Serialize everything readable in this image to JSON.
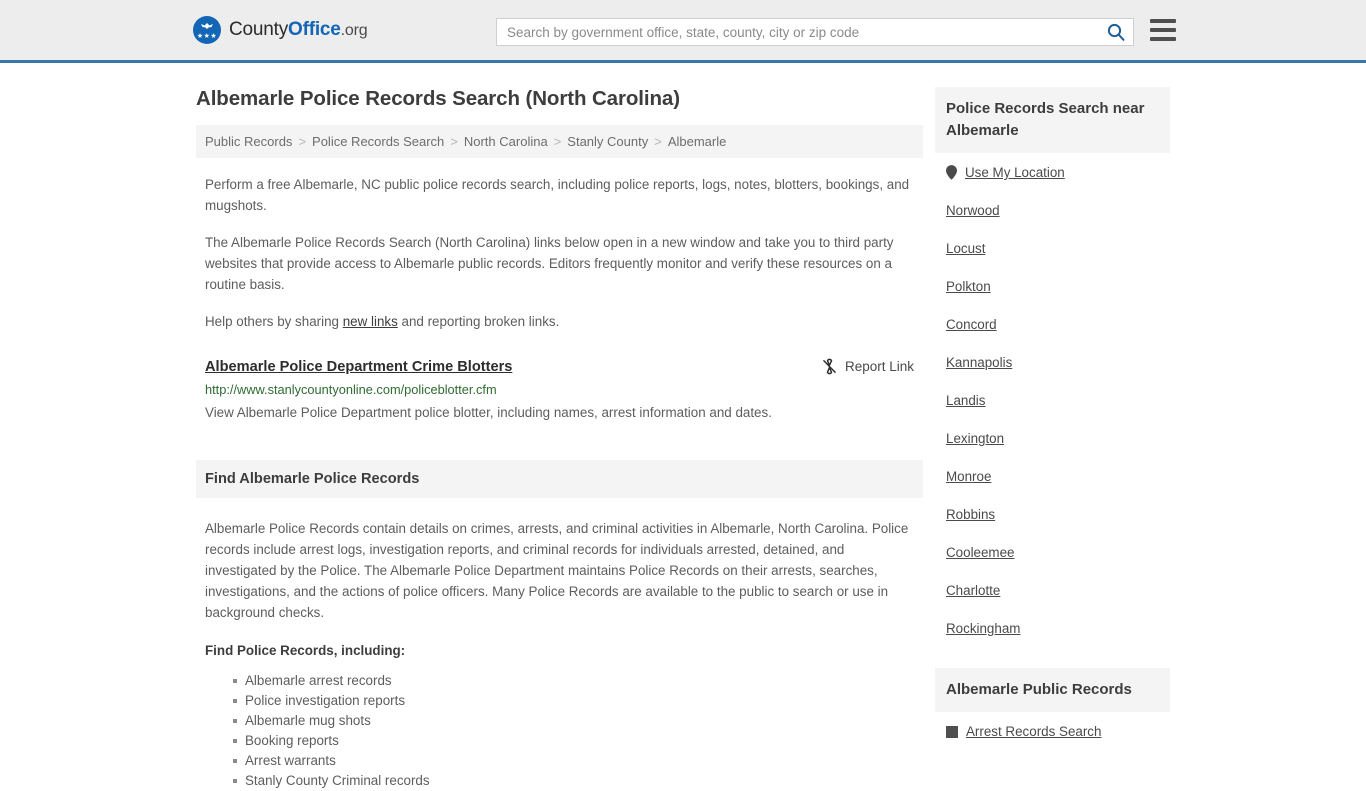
{
  "header": {
    "brand": {
      "part1": "County",
      "part2": "Office",
      "part3": ".org",
      "logo_icon": "eagle-seal-icon",
      "stars": "★★★"
    },
    "search": {
      "placeholder": "Search by government office, state, county, city or zip code",
      "value": "",
      "icon": "search-icon"
    },
    "menu_icon": "hamburger-menu-icon",
    "accent_color": "#3a76a8",
    "background_color": "#ededed"
  },
  "page": {
    "title": "Albemarle Police Records Search (North Carolina)"
  },
  "breadcrumb": {
    "separator": ">",
    "items": [
      "Public Records",
      "Police Records Search",
      "North Carolina",
      "Stanly County",
      "Albemarle"
    ]
  },
  "intro": {
    "p1": "Perform a free Albemarle, NC public police records search, including police reports, logs, notes, blotters, bookings, and mugshots.",
    "p2": "The Albemarle Police Records Search (North Carolina) links below open in a new window and take you to third party websites that provide access to Albemarle public records. Editors frequently monitor and verify these resources on a routine basis.",
    "p3_before": "Help others by sharing ",
    "p3_link": "new links",
    "p3_after": " and reporting broken links."
  },
  "result": {
    "title": "Albemarle Police Department Crime Blotters",
    "url": "http://www.stanlycountyonline.com/policeblotter.cfm",
    "url_color": "#2f6b32",
    "description": "View Albemarle Police Department police blotter, including names, arrest information and dates.",
    "report_label": "Report Link",
    "report_icon": "broken-link-icon"
  },
  "section": {
    "heading": "Find Albemarle Police Records",
    "body": "Albemarle Police Records contain details on crimes, arrests, and criminal activities in Albemarle, North Carolina. Police records include arrest logs, investigation reports, and criminal records for individuals arrested, detained, and investigated by the Police. The Albemarle Police Department maintains Police Records on their arrests, searches, investigations, and the actions of police officers. Many Police Records are available to the public to search or use in background checks.",
    "list_heading": "Find Police Records, including:",
    "bullets": [
      "Albemarle arrest records",
      "Police investigation reports",
      "Albemarle mug shots",
      "Booking reports",
      "Arrest warrants",
      "Stanly County Criminal records"
    ]
  },
  "sidebar": {
    "nearby": {
      "heading": "Police Records Search near Albemarle",
      "use_my_location": "Use My Location",
      "location_icon": "map-pin-icon",
      "cities": [
        "Norwood",
        "Locust",
        "Polkton",
        "Concord",
        "Kannapolis",
        "Landis",
        "Lexington",
        "Monroe",
        "Robbins",
        "Cooleemee",
        "Charlotte",
        "Rockingham"
      ]
    },
    "public_records": {
      "heading": "Albemarle Public Records",
      "items": [
        {
          "label": "Arrest Records Search",
          "icon": "square-bullet-icon"
        }
      ]
    }
  }
}
